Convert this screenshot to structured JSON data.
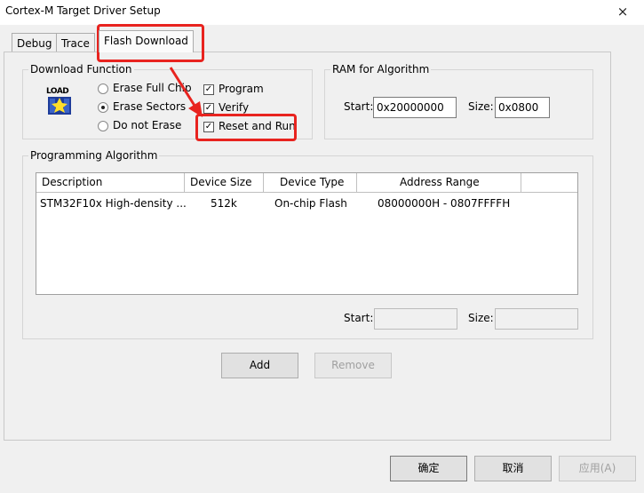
{
  "window": {
    "title": "Cortex-M Target Driver Setup",
    "close_glyph": "×"
  },
  "tabs": [
    {
      "label": "Debug"
    },
    {
      "label": "Trace"
    },
    {
      "label": "Flash Download"
    }
  ],
  "download_function": {
    "title": "Download Function",
    "icon_text": "LOAD",
    "radios": [
      {
        "label": "Erase Full Chip",
        "selected": false
      },
      {
        "label": "Erase Sectors",
        "selected": true
      },
      {
        "label": "Do not Erase",
        "selected": false
      }
    ],
    "checks": [
      {
        "label": "Program",
        "checked": true
      },
      {
        "label": "Verify",
        "checked": true
      },
      {
        "label": "Reset and Run",
        "checked": true
      }
    ]
  },
  "ram": {
    "title": "RAM for Algorithm",
    "start_label": "Start:",
    "start_value": "0x20000000",
    "size_label": "Size:",
    "size_value": "0x0800"
  },
  "algorithm": {
    "title": "Programming Algorithm",
    "columns": [
      "Description",
      "Device Size",
      "Device Type",
      "Address Range"
    ],
    "rows": [
      [
        "STM32F10x High-density ...",
        "512k",
        "On-chip Flash",
        "08000000H - 0807FFFFH"
      ]
    ],
    "start_label": "Start:",
    "start_value": "",
    "size_label": "Size:",
    "size_value": ""
  },
  "buttons": {
    "add": "Add",
    "remove": "Remove",
    "ok": "确定",
    "cancel": "取消",
    "apply": "应用(A)"
  },
  "annotation_color": "#e8231f"
}
